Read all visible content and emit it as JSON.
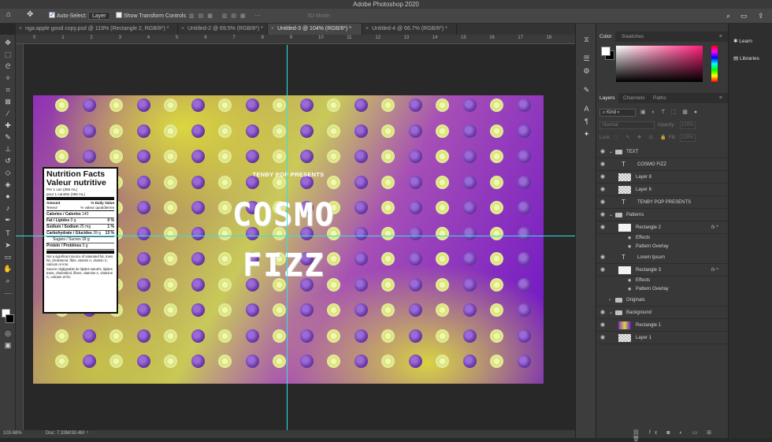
{
  "app": {
    "title": "Adobe Photoshop 2020"
  },
  "options_bar": {
    "auto_select_label": "Auto-Select:",
    "auto_select_value": "Layer",
    "show_transform_label": "Show Transform Controls",
    "mode_3d_label": "3D Mode:"
  },
  "tabs": [
    {
      "label": "nga:apple good copy.psd @ 119% (Rectangle 2, RGB/8*) *",
      "active": false
    },
    {
      "label": "Untitled-2 @ 69.5% (RGB/8*) *",
      "active": false
    },
    {
      "label": "Untitled-3 @ 104% (RGB/8*) *",
      "active": true
    },
    {
      "label": "Untitled-4 @ 66.7% (RGB/8*) *",
      "active": false
    }
  ],
  "ruler_ticks": [
    "0",
    "1",
    "2",
    "3",
    "4",
    "5",
    "6",
    "7",
    "8",
    "9",
    "10",
    "11",
    "12",
    "13",
    "14",
    "15",
    "16",
    "17",
    "18"
  ],
  "canvas": {
    "presents": "TENBY POP PRESENTS",
    "title_line1": "COSMO",
    "title_line2": "FIZZ"
  },
  "nutrition": {
    "title_en": "Nutrition Facts",
    "title_fr": "Valeur nutritive",
    "serving_en": "Per 1 can (355 mL)",
    "serving_fr": "pour 1 canette (355 mL)",
    "amount_en": "Amount",
    "amount_fr": "Teneur",
    "dv_en": "% Daily Value",
    "dv_fr": "% valeur quotidienne",
    "rows": [
      {
        "label": "Calories / Calories",
        "amount": "140",
        "dv": ""
      },
      {
        "label": "Fat / Lipides",
        "amount": "0 g",
        "dv": "0 %"
      },
      {
        "label": "Sodium / Sodium",
        "amount": "25 mg",
        "dv": "1 %"
      },
      {
        "label": "Carbohydrate / Glucides",
        "amount": "39 g",
        "dv": "13 %"
      },
      {
        "label": "Sugars / Sucres",
        "amount": "39 g",
        "dv": ""
      },
      {
        "label": "Protein / Protéines",
        "amount": "0 g",
        "dv": ""
      }
    ],
    "footer_en": "Not a significant source of saturated fat, trans fat, cholesterol, fibre, vitamin A, vitamin C, calcium or iron.",
    "footer_fr": "Source négligeable de lipides saturés, lipides trans, cholestérol, fibres, vitamine A, vitamine C, calcium et fer."
  },
  "status": {
    "zoom": "103.68%",
    "doc": "Doc: 7.33M/30.4M"
  },
  "color_panel": {
    "tabs": [
      "Color",
      "Swatches"
    ]
  },
  "layers_panel": {
    "tabs": [
      "Layers",
      "Channels",
      "Paths"
    ],
    "filter_kind": "Kind",
    "blend_mode": "Normal",
    "opacity_label": "Opacity:",
    "opacity_value": "100%",
    "lock_label": "Lock:",
    "fill_label": "Fill:",
    "fill_value": "100%",
    "layers": [
      {
        "name": "TEXT",
        "kind": "group",
        "indent": 0
      },
      {
        "name": "COSMO FIZZ",
        "kind": "text",
        "indent": 1
      },
      {
        "name": "Layer 8",
        "kind": "pixel",
        "indent": 1
      },
      {
        "name": "Layer 6",
        "kind": "pixel",
        "indent": 1
      },
      {
        "name": "TENBY POP PRESENTS",
        "kind": "text",
        "indent": 1
      },
      {
        "name": "Patterns",
        "kind": "group",
        "indent": 0
      },
      {
        "name": "Rectangle 2",
        "kind": "shape",
        "indent": 1,
        "fx": "fx"
      },
      {
        "name": "Effects",
        "kind": "effect",
        "indent": 2
      },
      {
        "name": "Pattern Overlay",
        "kind": "effect",
        "indent": 2
      },
      {
        "name": "Lorem Ipsum",
        "kind": "text",
        "indent": 1
      },
      {
        "name": "Rectangle 3",
        "kind": "shape",
        "indent": 1,
        "fx": "fx"
      },
      {
        "name": "Effects",
        "kind": "effect",
        "indent": 2
      },
      {
        "name": "Pattern Overlay",
        "kind": "effect",
        "indent": 2
      },
      {
        "name": "Originals",
        "kind": "group",
        "indent": 0
      },
      {
        "name": "Background",
        "kind": "group",
        "indent": 0
      },
      {
        "name": "Rectangle 1",
        "kind": "gradient",
        "indent": 1
      },
      {
        "name": "Layer 1",
        "kind": "pixel",
        "indent": 1
      }
    ]
  },
  "learn_panel": {
    "learn": "Learn",
    "libraries": "Libraries"
  },
  "colors": {
    "guide": "#2ee2e8",
    "accent": "#1a6bd8"
  }
}
